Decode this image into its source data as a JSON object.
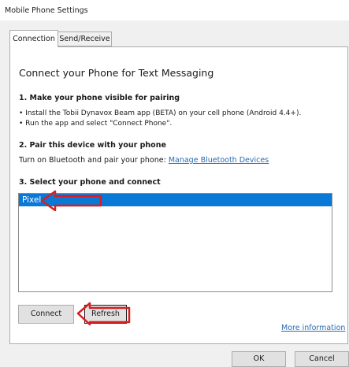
{
  "window": {
    "title": "Mobile Phone Settings"
  },
  "tabs": [
    {
      "label": "Connection",
      "active": true
    },
    {
      "label": "Send/Receive",
      "active": false
    }
  ],
  "panel": {
    "heading": "Connect your Phone for Text Messaging",
    "step1": {
      "title": "1. Make your phone visible for pairing",
      "bullet1": "• Install the Tobii Dynavox Beam app (BETA) on your cell phone (Android 4.4+).",
      "bullet2": "• Run the app and select \"Connect Phone\"."
    },
    "step2": {
      "title": "2. Pair this device with your phone",
      "text": "Turn on Bluetooth and pair your phone:",
      "link": "Manage Bluetooth Devices"
    },
    "step3": {
      "title": "3. Select your phone and connect",
      "devices": [
        "Pixel"
      ]
    },
    "buttons": {
      "connect": "Connect",
      "refresh": "Refresh"
    },
    "more_info": "More information"
  },
  "dialog_buttons": {
    "ok": "OK",
    "cancel": "Cancel"
  },
  "colors": {
    "selection": "#0a78d7",
    "annotation": "#d42020",
    "link": "#2a6bb4"
  }
}
